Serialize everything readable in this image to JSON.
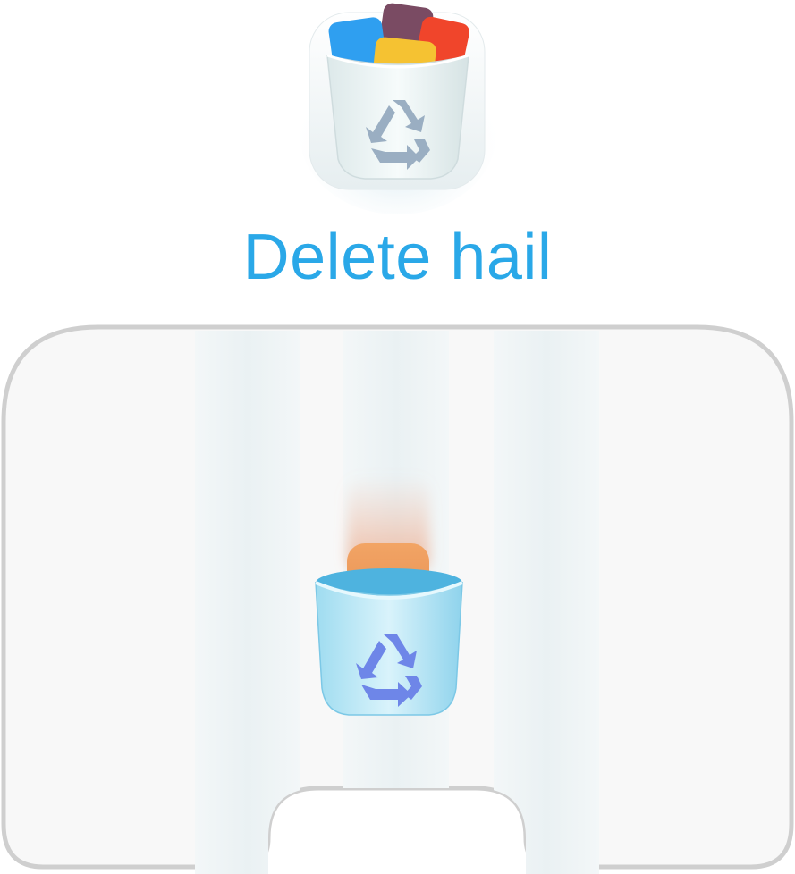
{
  "title": "Delete hail",
  "app_icon": {
    "icon": "recycle-bin-icon",
    "card_colors": [
      "#2f9ff0",
      "#7a4b63",
      "#f0452b",
      "#f5c232"
    ],
    "bin_color": "#e9f3f3",
    "recycle_symbol_color": "#9aaec2"
  },
  "board": {
    "lanes": 3,
    "border_color": "#cfcfcf",
    "background_color": "#f8f8f8",
    "lane_color": "#eef4f6"
  },
  "player_bin": {
    "icon": "recycle-bin-icon",
    "lane": 2,
    "bin_color": "#bfe6f4",
    "recycle_symbol_color": "#6e86e8"
  },
  "falling_item": {
    "icon": "square-tile-icon",
    "color": "#ee9a5a",
    "lane": 2
  },
  "colors": {
    "title": "#2aa8e8"
  }
}
